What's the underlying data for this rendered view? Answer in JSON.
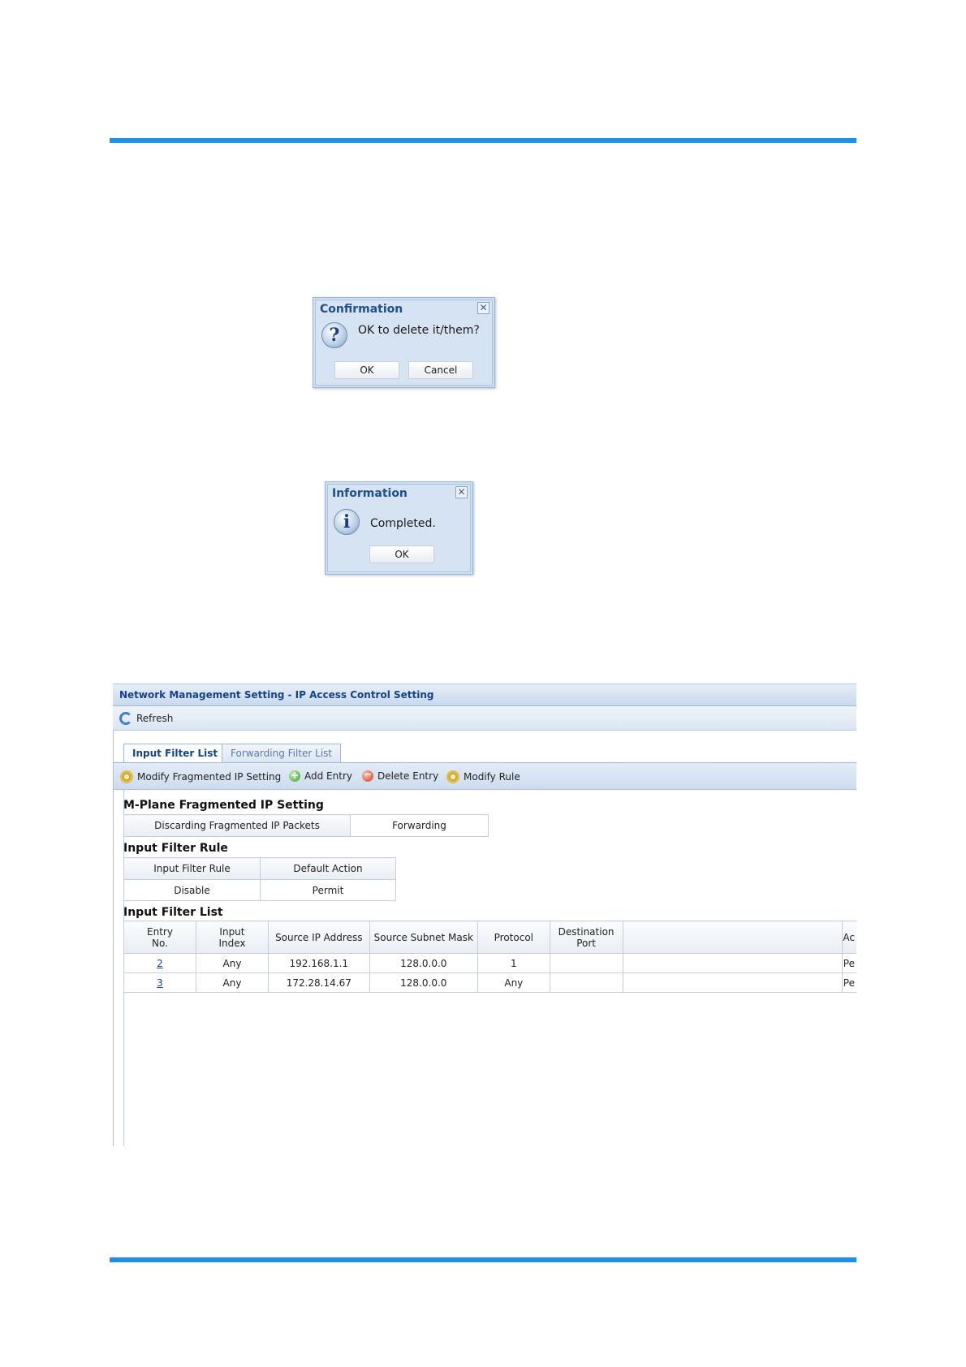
{
  "confirmation_dialog": {
    "title": "Confirmation",
    "close_glyph": "✕",
    "icon_glyph": "?",
    "message": "OK to delete it/them?",
    "ok_label": "OK",
    "cancel_label": "Cancel"
  },
  "information_dialog": {
    "title": "Information",
    "close_glyph": "✕",
    "icon_glyph": "i",
    "message": "Completed.",
    "ok_label": "OK"
  },
  "panel": {
    "title": "Network Management Setting - IP Access Control Setting",
    "refresh_label": "Refresh",
    "tabs": [
      {
        "label": "Input Filter List",
        "active": true
      },
      {
        "label": "Forwarding Filter List",
        "active": false
      }
    ],
    "actions": {
      "modify_fragmented": "Modify Fragmented IP Setting",
      "add_entry": "Add Entry",
      "delete_entry": "Delete Entry",
      "modify_rule": "Modify Rule"
    },
    "fragmented": {
      "title": "M-Plane Fragmented IP Setting",
      "label": "Discarding Fragmented IP Packets",
      "value": "Forwarding"
    },
    "filter_rule": {
      "title": "Input Filter Rule",
      "headers": [
        "Input Filter Rule",
        "Default Action"
      ],
      "values": [
        "Disable",
        "Permit"
      ]
    },
    "filter_list": {
      "title": "Input Filter List",
      "headers": [
        "Entry No.",
        "Input Index",
        "Source IP Address",
        "Source Subnet Mask",
        "Protocol",
        "Destination Port",
        "",
        "Ac"
      ],
      "rows": [
        {
          "entry": "2",
          "index": "Any",
          "src_ip": "192.168.1.1",
          "mask": "128.0.0.0",
          "protocol": "1",
          "dport": "",
          "blank": "",
          "action": "Pe"
        },
        {
          "entry": "3",
          "index": "Any",
          "src_ip": "172.28.14.67",
          "mask": "128.0.0.0",
          "protocol": "Any",
          "dport": "",
          "blank": "",
          "action": "Pe"
        }
      ]
    }
  }
}
